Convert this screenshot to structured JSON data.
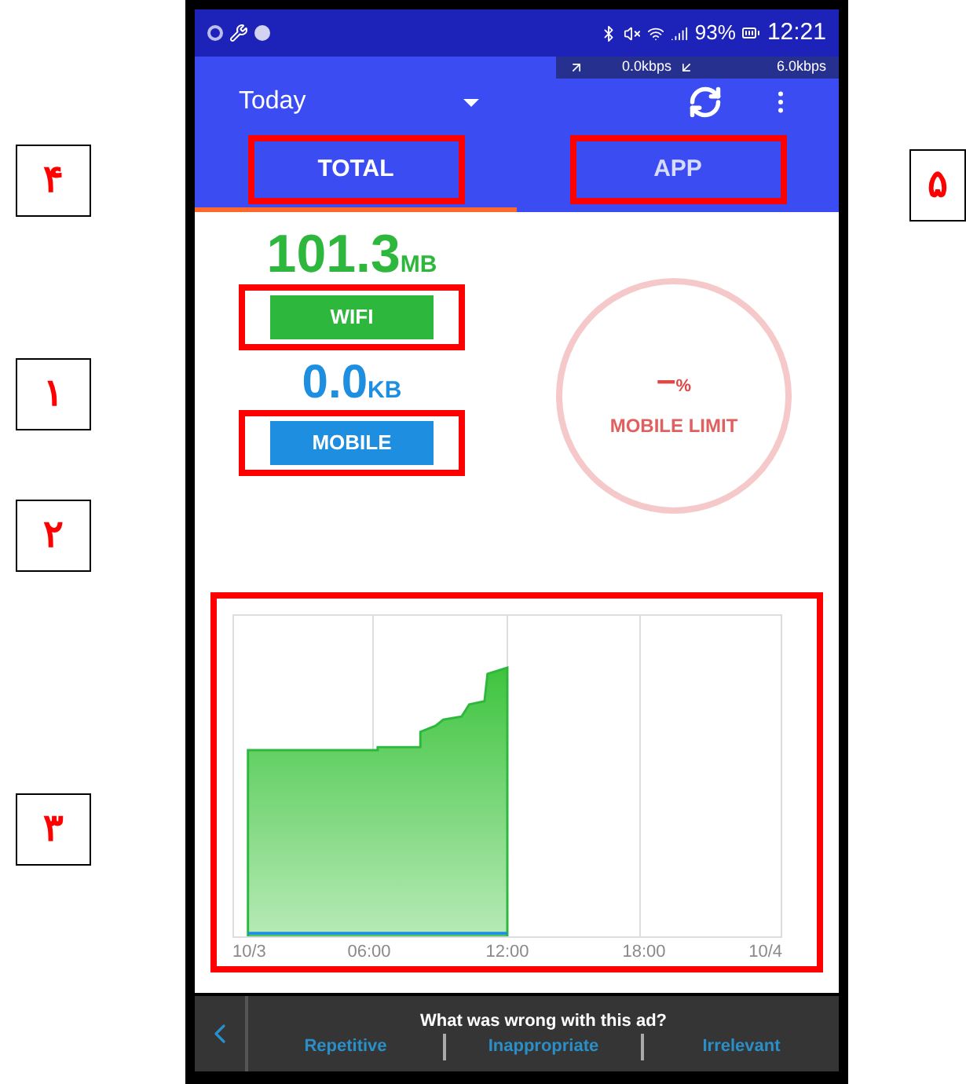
{
  "status_bar": {
    "battery": "93%",
    "time": "12:21"
  },
  "speed": {
    "up": "0.0kbps",
    "down": "6.0kbps"
  },
  "toolbar": {
    "period": "Today"
  },
  "tabs": [
    {
      "label": "TOTAL",
      "selected": true
    },
    {
      "label": "APP",
      "selected": false
    }
  ],
  "usage": [
    {
      "amount": "101.3",
      "unit": "MB",
      "label": "WIFI",
      "color": "#2db83d"
    },
    {
      "amount": "0.0",
      "unit": "KB",
      "label": "MOBILE",
      "color": "#1e8fe0"
    }
  ],
  "limit": {
    "value": "–",
    "unit": "%",
    "label": "MOBILE LIMIT"
  },
  "chart": {
    "x_labels": [
      "10/3",
      "06:00",
      "12:00",
      "18:00",
      "10/4"
    ]
  },
  "ad": {
    "question": "What was wrong with this ad?",
    "options": [
      "Repetitive",
      "Inappropriate",
      "Irrelevant"
    ]
  },
  "annotations": [
    {
      "label": "۴"
    },
    {
      "label": "۵"
    },
    {
      "label": "۱"
    },
    {
      "label": "۲"
    },
    {
      "label": "۳"
    }
  ]
}
